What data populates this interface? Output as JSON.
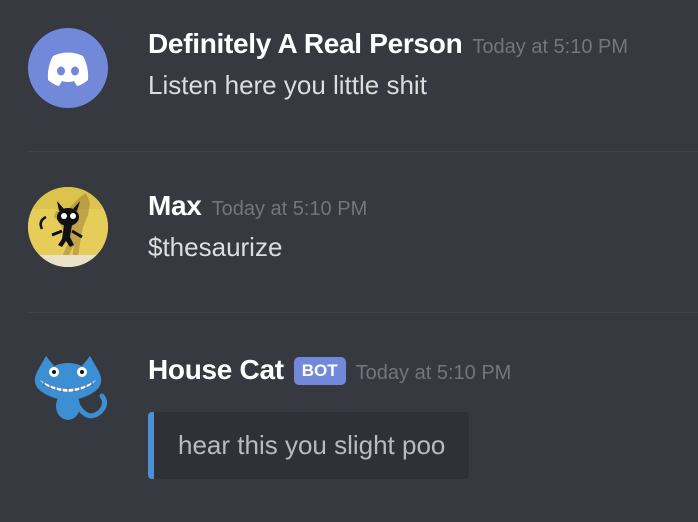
{
  "messages": [
    {
      "username": "Definitely A Real Person",
      "timestamp": "Today at 5:10 PM",
      "text": "Listen here you little shit",
      "avatar": "discord-logo-icon",
      "avatar_color": "#7289da"
    },
    {
      "username": "Max",
      "timestamp": "Today at 5:10 PM",
      "text": "$thesaurize",
      "avatar": "black-cat-cartoon-avatar"
    },
    {
      "username": "House Cat",
      "badge": "BOT",
      "timestamp": "Today at 5:10 PM",
      "embed_text": "hear this you slight poo",
      "avatar": "blue-cat-avatar",
      "embed_accent": "#4f8fd8"
    }
  ],
  "colors": {
    "background": "#36393f",
    "username": "#ffffff",
    "timestamp": "#72767d",
    "message_text": "#dcddde",
    "bot_badge": "#7289da",
    "embed_background": "#2f3136"
  }
}
